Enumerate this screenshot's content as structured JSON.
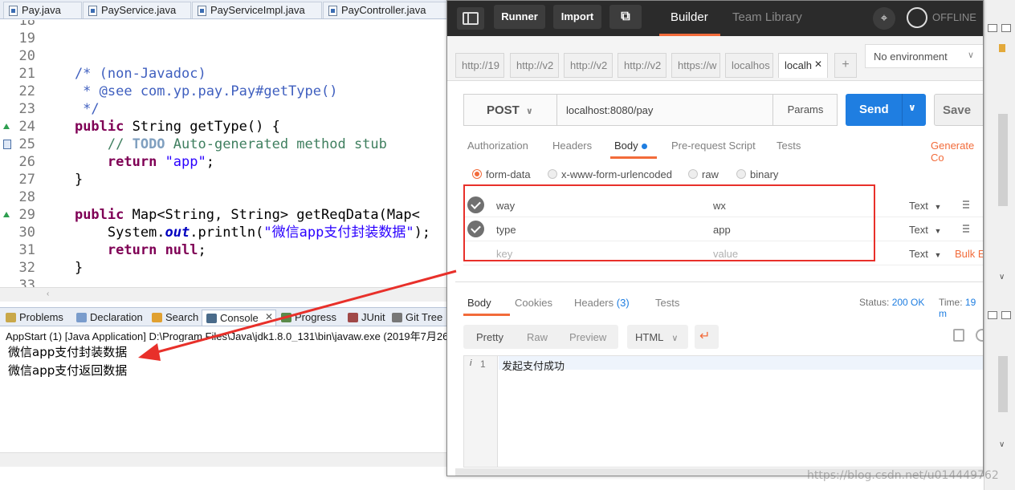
{
  "eclipse": {
    "tabs": [
      {
        "label": "Pay.java"
      },
      {
        "label": "PayService.java"
      },
      {
        "label": "PayServiceImpl.java"
      },
      {
        "label": "PayController.java"
      }
    ],
    "code_lines": [
      {
        "num": "18",
        "text": ""
      },
      {
        "num": "19",
        "text": ""
      },
      {
        "num": "20",
        "text": ""
      },
      {
        "num": "21",
        "text": "    /* (non-Javadoc)"
      },
      {
        "num": "22",
        "text": "     * @see com.yp.pay.Pay#getType()"
      },
      {
        "num": "23",
        "text": "     */"
      },
      {
        "num": "24",
        "text": "    public String getType() {"
      },
      {
        "num": "25",
        "text": "        // TODO Auto-generated method stub"
      },
      {
        "num": "26",
        "text": "        return \"app\";"
      },
      {
        "num": "27",
        "text": "    }"
      },
      {
        "num": "28",
        "text": ""
      },
      {
        "num": "29",
        "text": "    public Map<String, String> getReqData(Map<"
      },
      {
        "num": "30",
        "text": "        System.out.println(\"微信app支付封装数据\");"
      },
      {
        "num": "31",
        "text": "        return null;"
      },
      {
        "num": "32",
        "text": "    }"
      },
      {
        "num": "33",
        "text": ""
      }
    ],
    "views": [
      {
        "label": "Problems"
      },
      {
        "label": "Declaration"
      },
      {
        "label": "Search"
      },
      {
        "label": "Console"
      },
      {
        "label": "Progress"
      },
      {
        "label": "JUnit"
      },
      {
        "label": "Git Tree"
      }
    ],
    "console_header": "AppStart (1) [Java Application] D:\\Program Files\\Java\\jdk1.8.0_131\\bin\\javaw.exe (2019年7月26",
    "console_lines": [
      "微信app支付封装数据",
      "微信app支付返回数据"
    ]
  },
  "postman": {
    "header": {
      "runner": "Runner",
      "import": "Import",
      "builder": "Builder",
      "team_library": "Team Library",
      "offline": "OFFLINE"
    },
    "request_tabs": [
      "http://19",
      "http://v2",
      "http://v2",
      "http://v2",
      "https://w",
      "localhos",
      "localh"
    ],
    "environment": "No environment",
    "method": "POST",
    "url": "localhost:8080/pay",
    "params_label": "Params",
    "send_label": "Send",
    "save_label": "Save",
    "subtabs": [
      "Authorization",
      "Headers",
      "Body",
      "Pre-request Script",
      "Tests"
    ],
    "generate_code": "Generate Co",
    "body_modes": [
      "form-data",
      "x-www-form-urlencoded",
      "raw",
      "binary"
    ],
    "form_rows": [
      {
        "key": "way",
        "value": "wx",
        "type": "Text"
      },
      {
        "key": "type",
        "value": "app",
        "type": "Text"
      }
    ],
    "placeholder_row": {
      "key": "key",
      "value": "value",
      "type": "Text",
      "bulk": "Bulk E"
    },
    "response": {
      "tabs": [
        "Body",
        "Cookies",
        "Headers",
        "Tests"
      ],
      "headers_count": "(3)",
      "status_label": "Status:",
      "status_value": "200 OK",
      "time_label": "Time:",
      "time_value": "19 m",
      "view_modes": [
        "Pretty",
        "Raw",
        "Preview"
      ],
      "format": "HTML",
      "line_number": "1",
      "line_text": "发起支付成功"
    },
    "colors": {
      "accent": "#f26b3a",
      "send": "#1f7ee1",
      "annotation": "#e8302a"
    }
  },
  "watermark": "https://blog.csdn.net/u014449762"
}
